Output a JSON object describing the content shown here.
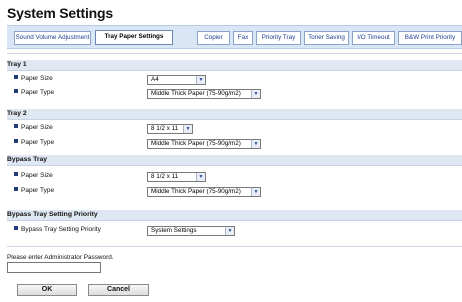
{
  "page": {
    "title": "System Settings"
  },
  "tabs": [
    {
      "label": "Sound Volume Adjustment",
      "active": false
    },
    {
      "label": "Tray Paper Settings",
      "active": true
    },
    {
      "label": "Copier",
      "active": false
    },
    {
      "label": "Fax",
      "active": false
    },
    {
      "label": "Priority Tray",
      "active": false
    },
    {
      "label": "Toner Saving",
      "active": false
    },
    {
      "label": "I/O Timeout",
      "active": false
    },
    {
      "label": "B&W Print Priority",
      "active": false
    }
  ],
  "sections": {
    "tray1": {
      "title": "Tray 1",
      "paper_size_label": "Paper Size",
      "paper_size_value": "A4",
      "paper_type_label": "Paper Type",
      "paper_type_value": "Middle Thick Paper (75-90g/m2)"
    },
    "tray2": {
      "title": "Tray 2",
      "paper_size_label": "Paper Size",
      "paper_size_value": "8 1/2 x 11",
      "paper_type_label": "Paper Type",
      "paper_type_value": "Middle Thick Paper (75-90g/m2)"
    },
    "bypass": {
      "title": "Bypass Tray",
      "paper_size_label": "Paper Size",
      "paper_size_value": "8 1/2 x 11",
      "paper_type_label": "Paper Type",
      "paper_type_value": "Middle Thick Paper (75-90g/m2)"
    },
    "bypass_priority": {
      "title": "Bypass Tray Setting Priority",
      "label": "Bypass Tray Setting Priority",
      "value": "System Settings"
    }
  },
  "password": {
    "label": "Please enter Administrator Password.",
    "value": ""
  },
  "buttons": {
    "ok": "OK",
    "cancel": "Cancel"
  },
  "icons": {
    "dropdown": "chevron-down-icon",
    "bullet": "square-bullet-icon"
  },
  "colors": {
    "tab_bar": "#d9e6f5",
    "section_bar": "#dfe8f2",
    "link": "#1f3f8f"
  }
}
